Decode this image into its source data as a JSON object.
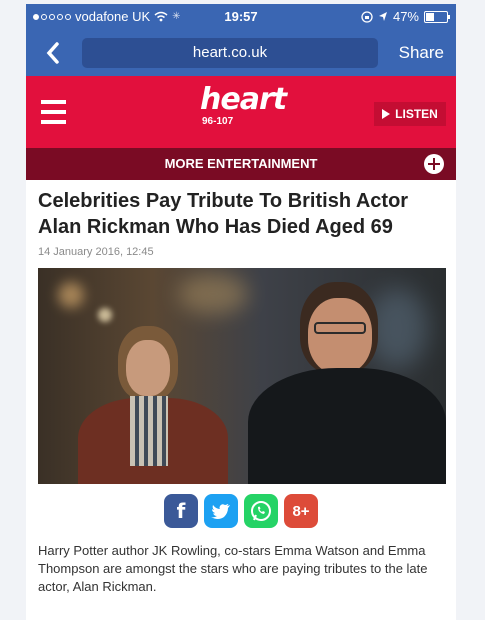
{
  "status": {
    "carrier": "vodafone UK",
    "time": "19:57",
    "battery": "47%",
    "signal_bars": 1,
    "battery_level": 0.47
  },
  "browser": {
    "url": "heart.co.uk",
    "share_label": "Share",
    "back_icon": "chevron-left-icon"
  },
  "header": {
    "logo_word": "heart",
    "logo_freq": "96-107",
    "listen_label": "LISTEN",
    "menu_icon": "hamburger-icon"
  },
  "section_bar": {
    "label": "MORE ENTERTAINMENT",
    "icon": "plus-icon"
  },
  "article": {
    "headline": "Celebrities Pay Tribute To British Actor Alan Rickman Who Has Died Aged 69",
    "date": "14 January 2016, 12:45",
    "summary": "Harry Potter author JK Rowling, co-stars Emma Watson and Emma Thompson are amongst the stars who are paying tributes to the late actor, Alan Rickman."
  },
  "social": [
    {
      "name": "facebook",
      "glyph": "f",
      "color": "#3b5998"
    },
    {
      "name": "twitter",
      "glyph": "",
      "color": "#1da1f2"
    },
    {
      "name": "whatsapp",
      "glyph": "",
      "color": "#25d366"
    },
    {
      "name": "google-plus",
      "glyph": "8+",
      "color": "#dd4b39"
    }
  ],
  "colors": {
    "browser_blue": "#3a66b3",
    "heart_red": "#e2103d",
    "section_maroon": "#7a0b24"
  }
}
